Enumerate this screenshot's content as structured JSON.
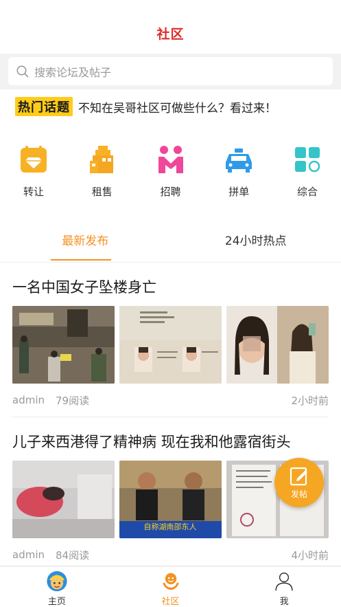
{
  "header": {
    "title": "社区"
  },
  "search": {
    "placeholder": "搜索论坛及帖子"
  },
  "hot_topic": {
    "badge": "热门话题",
    "text": "不知在吴哥社区可做些什么？看过来！"
  },
  "categories": [
    {
      "label": "转让",
      "icon": "diamond-icon"
    },
    {
      "label": "租售",
      "icon": "building-icon"
    },
    {
      "label": "招聘",
      "icon": "people-icon"
    },
    {
      "label": "拼单",
      "icon": "taxi-icon"
    },
    {
      "label": "综合",
      "icon": "grid-icon"
    }
  ],
  "tabs": [
    {
      "label": "最新发布",
      "active": true
    },
    {
      "label": "24小时热点",
      "active": false
    }
  ],
  "posts": [
    {
      "title": "一名中国女子坠楼身亡",
      "author": "admin",
      "reads": "79阅读",
      "time": "2小时前"
    },
    {
      "title": "儿子来西港得了精神病 现在我和他露宿街头",
      "author": "admin",
      "reads": "84阅读",
      "time": "4小时前"
    }
  ],
  "post_images": {
    "caption": "自称湖南邵东人"
  },
  "fab": {
    "label": "发帖",
    "icon": "edit-icon"
  },
  "bottom_nav": [
    {
      "label": "主页",
      "icon": "home-avatar-icon"
    },
    {
      "label": "社区",
      "icon": "community-icon",
      "active": true
    },
    {
      "label": "我",
      "icon": "profile-icon"
    }
  ],
  "colors": {
    "accent": "#f39224",
    "title_red": "#e02828",
    "badge_yellow": "#ffcc1a"
  }
}
